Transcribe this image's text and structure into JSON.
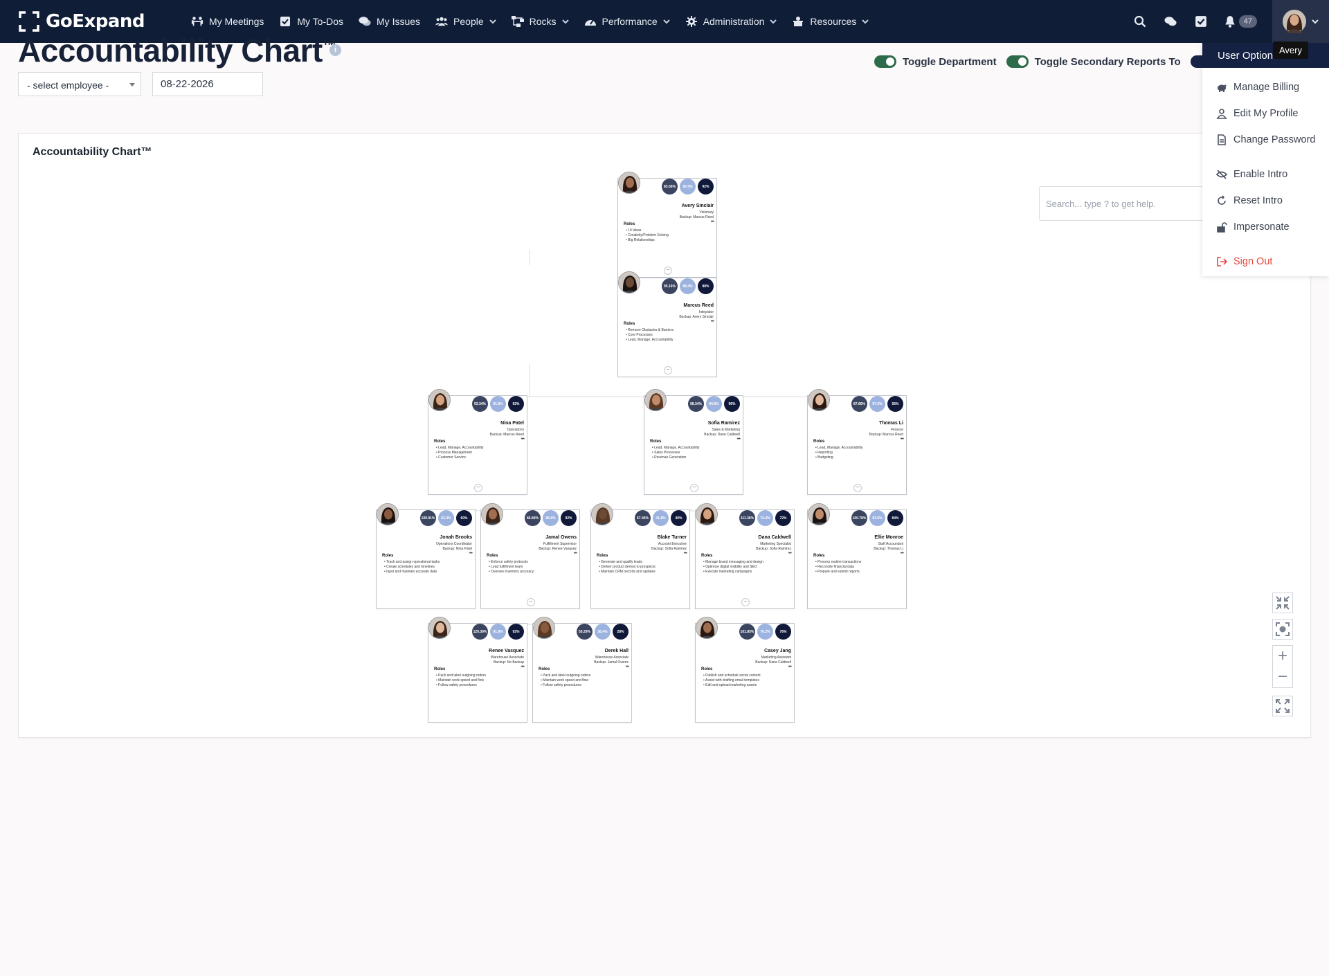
{
  "nav": {
    "brand": "GoExpand",
    "items": [
      {
        "label": "My Meetings",
        "icon": "meeting-icon",
        "has_dropdown": false
      },
      {
        "label": "My To-Dos",
        "icon": "checkbox-icon",
        "has_dropdown": false
      },
      {
        "label": "My Issues",
        "icon": "chat-icon",
        "has_dropdown": false
      },
      {
        "label": "People",
        "icon": "users-icon",
        "has_dropdown": true
      },
      {
        "label": "Rocks",
        "icon": "sitemap-icon",
        "has_dropdown": true
      },
      {
        "label": "Performance",
        "icon": "gauge-icon",
        "has_dropdown": true
      },
      {
        "label": "Administration",
        "icon": "gear-icon",
        "has_dropdown": true
      },
      {
        "label": "Resources",
        "icon": "box-icon",
        "has_dropdown": true
      }
    ],
    "notification_count": "47",
    "user_tooltip": "Avery"
  },
  "page": {
    "title": "Accountability Chart",
    "title_mark": "™",
    "employee_select": "- select employee -",
    "date": "08-22-2026",
    "toggles": [
      {
        "label": "Toggle Department",
        "on": true
      },
      {
        "label": "Toggle Secondary Reports To",
        "on": true
      }
    ]
  },
  "chart": {
    "title": "Accountability Chart™",
    "search_placeholder": "Search... type ? to get help.",
    "roles_heading": "Roles",
    "nodes": [
      {
        "id": "avery",
        "name": "Avery Sinclair",
        "seat": "Visionary",
        "backup": "Backup: Marcus Reed",
        "metrics": [
          "83.56%",
          "92.0%",
          "92%"
        ],
        "roles": [
          "10 Ideas",
          "Creativity/Problem Solving",
          "Big Relationships"
        ]
      },
      {
        "id": "marcus",
        "name": "Marcus Reed",
        "seat": "Integrator",
        "backup": "Backup: Avery Sinclair",
        "metrics": [
          "95.16%",
          "88.4%",
          "88%"
        ],
        "roles": [
          "Remove Obstacles & Barriers",
          "Core Processes",
          "Lead, Manage, Accountability"
        ]
      },
      {
        "id": "nina",
        "name": "Nina Patel",
        "seat": "Operations",
        "backup": "Backup: Marcus Reed",
        "metrics": [
          "93.34%",
          "91.6%",
          "92%"
        ],
        "roles": [
          "Lead, Manage, Accountability",
          "Process Management",
          "Customer Service"
        ]
      },
      {
        "id": "sofia",
        "name": "Sofia Ramirez",
        "seat": "Sales & Marketing",
        "backup": "Backup: Dana Caldwell",
        "metrics": [
          "98.34%",
          "94.6%",
          "96%"
        ],
        "roles": [
          "Lead, Manage, Accountability",
          "Sales Processes",
          "Revenue Generation"
        ]
      },
      {
        "id": "thomas",
        "name": "Thomas Li",
        "seat": "Finance",
        "backup": "Backup: Marcus Reed",
        "metrics": [
          "87.66%",
          "57.3%",
          "56%"
        ],
        "roles": [
          "Lead, Manage, Accountability",
          "Reporting",
          "Budgeting"
        ]
      },
      {
        "id": "jonah",
        "name": "Jonah Brooks",
        "seat": "Operations Coordinator",
        "backup": "Backup: Nina Patel",
        "metrics": [
          "109.01%",
          "62.3%",
          "60%"
        ],
        "roles": [
          "Track and assign operational tasks",
          "Create schedules and timelines",
          "Input and maintain accurate data"
        ]
      },
      {
        "id": "jamal",
        "name": "Jamal Owens",
        "seat": "Fulfillment Supervisor",
        "backup": "Backup: Renee Vasquez",
        "metrics": [
          "86.84%",
          "85.6%",
          "92%"
        ],
        "roles": [
          "Enforce safety protocols",
          "Lead fulfillment team",
          "Oversee inventory accuracy"
        ]
      },
      {
        "id": "blake",
        "name": "Blake Turner",
        "seat": "Account Executive",
        "backup": "Backup: Sofia Ramirez",
        "metrics": [
          "67.46%",
          "41.8%",
          "40%"
        ],
        "roles": [
          "Generate and qualify leads",
          "Deliver product demos to prospects",
          "Maintain CRM records and updates"
        ]
      },
      {
        "id": "dana",
        "name": "Dana Caldwell",
        "seat": "Marketing Specialist",
        "backup": "Backup: Sofia Ramirez",
        "metrics": [
          "111.36%",
          "74.4%",
          "72%"
        ],
        "roles": [
          "Manage brand messaging and design",
          "Optimize digital visibility and SEO",
          "Execute marketing campaigns"
        ]
      },
      {
        "id": "ellie",
        "name": "Ellie Monroe",
        "seat": "Staff Accountant",
        "backup": "Backup: Thomas Li",
        "metrics": [
          "100.78%",
          "83.6%",
          "84%"
        ],
        "roles": [
          "Process routine transactions",
          "Reconcile financial data",
          "Prepare and submit reports"
        ]
      },
      {
        "id": "renee",
        "name": "Renee Vasquez",
        "seat": "Warehouse Associate",
        "backup": "Backup: No Backup",
        "metrics": [
          "120.39%",
          "91.8%",
          "92%"
        ],
        "roles": [
          "Pack and label outgoing orders",
          "Maintain work speed and flow",
          "Follow safety procedures"
        ]
      },
      {
        "id": "derek",
        "name": "Derek Hall",
        "seat": "Warehouse Associate",
        "backup": "Backup: Jamal Owens",
        "metrics": [
          "55.29%",
          "38.4%",
          "28%"
        ],
        "roles": [
          "Pack and label outgoing orders",
          "Maintain work speed and flow",
          "Follow safety procedures"
        ]
      },
      {
        "id": "casey",
        "name": "Casey Jang",
        "seat": "Marketing Assistant",
        "backup": "Backup: Dana Caldwell",
        "metrics": [
          "101.85%",
          "76.2%",
          "76%"
        ],
        "roles": [
          "Publish and schedule social content",
          "Assist with drafting email templates",
          "Edit and upload marketing assets"
        ]
      }
    ]
  },
  "user_menu": {
    "header": "User Options",
    "items": [
      {
        "label": "Manage Billing",
        "icon": "piggy-bank-icon"
      },
      {
        "label": "Edit My Profile",
        "icon": "user-icon"
      },
      {
        "label": "Change Password",
        "icon": "document-icon"
      },
      {
        "label": "Enable Intro",
        "icon": "eye-slash-icon"
      },
      {
        "label": "Reset Intro",
        "icon": "refresh-icon"
      },
      {
        "label": "Impersonate",
        "icon": "unlock-icon"
      },
      {
        "label": "Sign Out",
        "icon": "sign-out-icon"
      }
    ]
  },
  "colors": {
    "navbar": "#0f1d36",
    "metric_dark": "#3b4560",
    "metric_light": "#9db3df",
    "metric_navy": "#11193a",
    "toggle_green": "#2e6b4a",
    "danger": "#e5483e"
  }
}
